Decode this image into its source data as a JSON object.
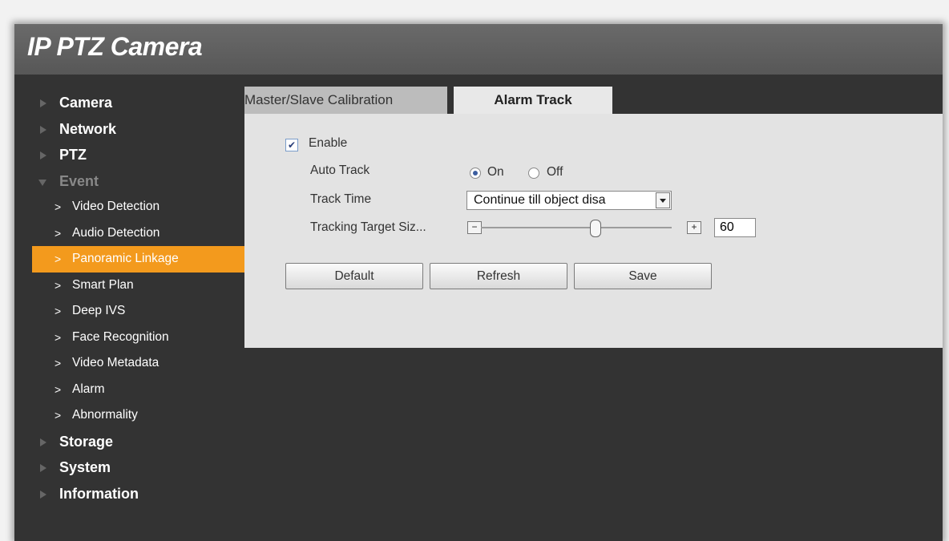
{
  "header": {
    "title": "IP PTZ Camera"
  },
  "sidebar": {
    "top_items": [
      {
        "label": "Camera"
      },
      {
        "label": "Network"
      },
      {
        "label": "PTZ"
      },
      {
        "label": "Event"
      }
    ],
    "event_sub_items": [
      {
        "label": "Video Detection"
      },
      {
        "label": "Audio Detection"
      },
      {
        "label": "Panoramic Linkage"
      },
      {
        "label": "Smart Plan"
      },
      {
        "label": "Deep IVS"
      },
      {
        "label": "Face Recognition"
      },
      {
        "label": "Video Metadata"
      },
      {
        "label": "Alarm"
      },
      {
        "label": "Abnormality"
      }
    ],
    "bottom_items": [
      {
        "label": "Storage"
      },
      {
        "label": "System"
      },
      {
        "label": "Information"
      }
    ],
    "active_item": "Panoramic Linkage",
    "active_color": "#f39a1d"
  },
  "tabs": [
    {
      "label": "Master/Slave Calibration"
    },
    {
      "label": "Alarm Track"
    }
  ],
  "form": {
    "enable_label": "Enable",
    "enable_checked": true,
    "auto_track_label": "Auto Track",
    "auto_track_on": "On",
    "auto_track_off": "Off",
    "auto_track_value": "On",
    "track_time_label": "Track Time",
    "track_time_value": "Continue till object disa",
    "target_size_label": "Tracking Target Siz...",
    "target_size_value": "60",
    "target_size_minus": "−",
    "target_size_plus": "+"
  },
  "buttons": {
    "default": "Default",
    "refresh": "Refresh",
    "save": "Save"
  }
}
